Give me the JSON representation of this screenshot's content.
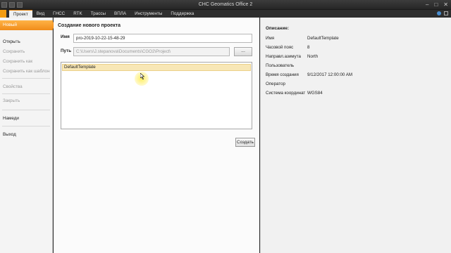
{
  "window": {
    "title": "CHC Geomatics Office 2"
  },
  "menu": {
    "items": [
      "Проект",
      "Вид",
      "ГНСС",
      "RTK",
      "Трассы",
      "ВПЛА",
      "Инструменты",
      "Поддержка"
    ],
    "active_index": 0
  },
  "sidebar": {
    "new": "Новый",
    "open": "Открыть",
    "save": "Сохранить",
    "save_as": "Сохранить как",
    "save_as_template": "Сохранить как шаблон",
    "properties": "Свойства",
    "close": "Закрыть",
    "nmea": "Намеди",
    "exit": "Выход"
  },
  "form": {
    "title": "Создание нового проекта",
    "name_label": "Имя",
    "name_value": "pro-2019-10-22-15-48-29",
    "path_label": "Путь",
    "path_value": "C:\\Users\\J.stepanova\\Documents\\CGO2\\Project\\",
    "browse_label": "...",
    "templates": [
      "DefaultTemplate"
    ],
    "selected_template": "DefaultTemplate",
    "create_button": "Создать"
  },
  "description": {
    "title": "Описание:",
    "rows": [
      {
        "key": "Имя",
        "value": "DefaultTemplate"
      },
      {
        "key": "Часовой пояс",
        "value": "8"
      },
      {
        "key": "Направл.азимута",
        "value": "North"
      },
      {
        "key": "Пользователь",
        "value": ""
      },
      {
        "key": "Время создания",
        "value": "9/12/2017 12:00:00 AM"
      },
      {
        "key": "Оператор",
        "value": ""
      },
      {
        "key": "Система координат",
        "value": "WGS84"
      }
    ]
  },
  "colors": {
    "accent": "#f08c1a",
    "selection": "#f8e7b6"
  }
}
